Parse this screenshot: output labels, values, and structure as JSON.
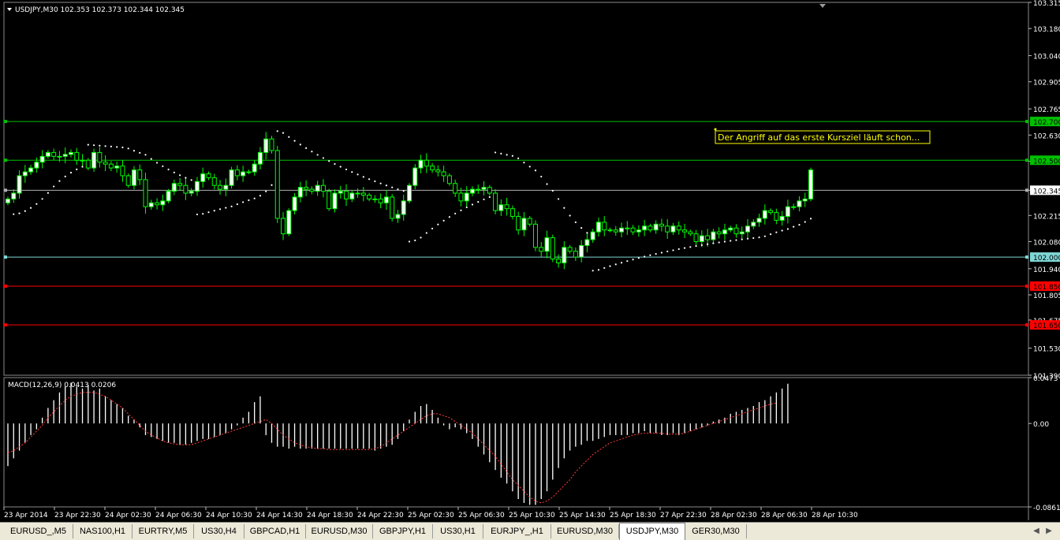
{
  "colors": {
    "background": "#000000",
    "up_candle": "#ffffff",
    "down_candle": "#000000",
    "candle_outline": "#00ff00",
    "macd_hist": "#ffffff",
    "macd_signal": "#ff3b3b",
    "green_line": "#00c000",
    "red_line": "#ff0000",
    "price_line": "#b0b0b0",
    "cyan_line": "#7fd7d7",
    "annotation": "#ffff00"
  },
  "header": {
    "symbol_label": "USDJPY,M30  102.353 102.373 102.344 102.345"
  },
  "annotation": {
    "text": "Der Angriff auf das erste Kursziel läuft schon..."
  },
  "chart_data": [
    {
      "type": "candlestick",
      "title": "USDJPY,M30",
      "ohlc_header": [
        102.353,
        102.373,
        102.344,
        102.345
      ],
      "ylim": [
        101.39,
        103.315
      ],
      "y_ticks": [
        "103.315",
        "103.180",
        "103.040",
        "102.905",
        "102.765",
        "102.630",
        "102.495",
        "102.345",
        "102.215",
        "102.080",
        "101.940",
        "101.805",
        "101.675",
        "101.530",
        "101.390"
      ],
      "x_ticks": [
        "23 Apr 2014",
        "23 Apr 22:30",
        "24 Apr 02:30",
        "24 Apr 06:30",
        "24 Apr 10:30",
        "24 Apr 14:30",
        "24 Apr 18:30",
        "24 Apr 22:30",
        "25 Apr 02:30",
        "25 Apr 06:30",
        "25 Apr 10:30",
        "25 Apr 14:30",
        "25 Apr 18:30",
        "27 Apr 22:30",
        "28 Apr 02:30",
        "28 Apr 06:30",
        "28 Apr 10:30"
      ],
      "levels": [
        {
          "label": "102.700",
          "value": 102.7,
          "color": "#00c000",
          "tag_bg": "#00c000"
        },
        {
          "label": "102.500",
          "value": 102.5,
          "color": "#00c000",
          "tag_bg": "#00c000"
        },
        {
          "label": "102.345",
          "value": 102.345,
          "color": "#b0b0b0",
          "tag_bg": "#ffffff"
        },
        {
          "label": "102.000",
          "value": 102.0,
          "color": "#7fd7d7",
          "tag_bg": "#7fd7d7"
        },
        {
          "label": "101.850",
          "value": 101.85,
          "color": "#ff0000",
          "tag_bg": "#ff0000"
        },
        {
          "label": "101.650",
          "value": 101.65,
          "color": "#ff0000",
          "tag_bg": "#ff0000"
        }
      ],
      "close": [
        102.3,
        102.33,
        102.42,
        102.44,
        102.46,
        102.49,
        102.52,
        102.54,
        102.52,
        102.52,
        102.53,
        102.54,
        102.5,
        102.5,
        102.46,
        102.54,
        102.49,
        102.48,
        102.46,
        102.47,
        102.42,
        102.37,
        102.45,
        102.4,
        102.26,
        102.28,
        102.27,
        102.29,
        102.34,
        102.38,
        102.37,
        102.33,
        102.34,
        102.39,
        102.43,
        102.41,
        102.37,
        102.35,
        102.37,
        102.45,
        102.42,
        102.44,
        102.44,
        102.48,
        102.54,
        102.61,
        102.55,
        102.2,
        102.12,
        102.24,
        102.31,
        102.36,
        102.35,
        102.34,
        102.37,
        102.34,
        102.25,
        102.33,
        102.34,
        102.3,
        102.33,
        102.33,
        102.32,
        102.3,
        102.3,
        102.28,
        102.31,
        102.2,
        102.22,
        102.29,
        102.37,
        102.46,
        102.5,
        102.47,
        102.45,
        102.44,
        102.42,
        102.38,
        102.33,
        102.29,
        102.33,
        102.35,
        102.35,
        102.36,
        102.33,
        102.24,
        102.27,
        102.25,
        102.21,
        102.14,
        102.2,
        102.17,
        102.05,
        102.03,
        102.1,
        101.99,
        101.97,
        102.05,
        102.03,
        102.0,
        102.06,
        102.09,
        102.13,
        102.18,
        102.14,
        102.14,
        102.13,
        102.15,
        102.15,
        102.13,
        102.14,
        102.16,
        102.14,
        102.17,
        102.16,
        102.13,
        102.16,
        102.14,
        102.13,
        102.12,
        102.08,
        102.11,
        102.09,
        102.13,
        102.12,
        102.14,
        102.15,
        102.12,
        102.13,
        102.16,
        102.18,
        102.2,
        102.24,
        102.23,
        102.19,
        102.21,
        102.26,
        102.26,
        102.29,
        102.3,
        102.45
      ]
    },
    {
      "type": "bar",
      "title": "MACD(12,26,9) 0.0413 0.0206",
      "name": "MACD",
      "params": [
        12,
        26,
        9
      ],
      "header_values": [
        0.0413,
        0.0206
      ],
      "ylim": [
        -0.0861,
        0.0473
      ],
      "y_ticks": [
        "0.0473",
        "0.00",
        "-0.0861"
      ],
      "histogram": [
        -0.044,
        -0.036,
        -0.028,
        -0.02,
        -0.012,
        -0.006,
        0.006,
        0.016,
        0.024,
        0.032,
        0.038,
        0.042,
        0.038,
        0.036,
        0.04,
        0.034,
        0.036,
        0.028,
        0.024,
        0.02,
        0.016,
        0.008,
        0.004,
        -0.004,
        -0.012,
        -0.014,
        -0.016,
        -0.018,
        -0.02,
        -0.02,
        -0.022,
        -0.022,
        -0.02,
        -0.018,
        -0.016,
        -0.016,
        -0.014,
        -0.012,
        -0.01,
        -0.006,
        -0.002,
        0.006,
        0.012,
        0.022,
        0.028,
        -0.012,
        -0.02,
        -0.024,
        -0.024,
        -0.026,
        -0.024,
        -0.026,
        -0.026,
        -0.026,
        -0.026,
        -0.026,
        -0.026,
        -0.026,
        -0.026,
        -0.026,
        -0.026,
        -0.026,
        -0.026,
        -0.026,
        -0.028,
        -0.026,
        -0.024,
        -0.022,
        -0.016,
        -0.008,
        0.004,
        0.012,
        0.018,
        0.02,
        0.014,
        0.006,
        -0.002,
        -0.006,
        -0.004,
        -0.006,
        -0.01,
        -0.016,
        -0.024,
        -0.032,
        -0.04,
        -0.048,
        -0.056,
        -0.062,
        -0.07,
        -0.078,
        -0.082,
        -0.084,
        -0.084,
        -0.078,
        -0.07,
        -0.058,
        -0.046,
        -0.036,
        -0.028,
        -0.024,
        -0.022,
        -0.018,
        -0.018,
        -0.016,
        -0.014,
        -0.012,
        -0.012,
        -0.012,
        -0.012,
        -0.01,
        -0.01,
        -0.008,
        -0.01,
        -0.01,
        -0.012,
        -0.012,
        -0.01,
        -0.012,
        -0.01,
        -0.008,
        -0.006,
        -0.004,
        -0.002,
        0.002,
        0.004,
        0.006,
        0.01,
        0.012,
        0.014,
        0.016,
        0.018,
        0.022,
        0.024,
        0.028,
        0.032,
        0.036,
        0.041
      ],
      "signal": [
        -0.03,
        -0.028,
        -0.024,
        -0.02,
        -0.014,
        -0.008,
        -0.002,
        0.006,
        0.012,
        0.018,
        0.024,
        0.028,
        0.03,
        0.032,
        0.032,
        0.032,
        0.03,
        0.028,
        0.024,
        0.02,
        0.016,
        0.01,
        0.004,
        -0.002,
        -0.008,
        -0.012,
        -0.015,
        -0.018,
        -0.02,
        -0.021,
        -0.022,
        -0.022,
        -0.022,
        -0.02,
        -0.018,
        -0.016,
        -0.014,
        -0.012,
        -0.01,
        -0.008,
        -0.006,
        -0.004,
        -0.002,
        0.0,
        0.002,
        0.004,
        0.0,
        -0.006,
        -0.012,
        -0.016,
        -0.02,
        -0.022,
        -0.024,
        -0.025,
        -0.026,
        -0.026,
        -0.027,
        -0.027,
        -0.027,
        -0.027,
        -0.027,
        -0.027,
        -0.027,
        -0.027,
        -0.026,
        -0.024,
        -0.02,
        -0.016,
        -0.012,
        -0.008,
        -0.004,
        0.0,
        0.004,
        0.008,
        0.01,
        0.01,
        0.008,
        0.006,
        0.002,
        -0.002,
        -0.006,
        -0.01,
        -0.016,
        -0.022,
        -0.028,
        -0.034,
        -0.042,
        -0.05,
        -0.058,
        -0.064,
        -0.07,
        -0.076,
        -0.08,
        -0.082,
        -0.08,
        -0.076,
        -0.07,
        -0.064,
        -0.058,
        -0.05,
        -0.044,
        -0.038,
        -0.032,
        -0.028,
        -0.024,
        -0.02,
        -0.018,
        -0.016,
        -0.014,
        -0.012,
        -0.011,
        -0.01,
        -0.01,
        -0.01,
        -0.01,
        -0.011,
        -0.011,
        -0.011,
        -0.01,
        -0.008,
        -0.006,
        -0.004,
        -0.002,
        0.0,
        0.002,
        0.004,
        0.006,
        0.008,
        0.01,
        0.012,
        0.014,
        0.016,
        0.018,
        0.02,
        0.021
      ]
    }
  ],
  "tabs": [
    {
      "label": "EURUSD_,M5",
      "active": false
    },
    {
      "label": "NAS100,H1",
      "active": false
    },
    {
      "label": "EURTRY,M5",
      "active": false
    },
    {
      "label": "US30,H4",
      "active": false
    },
    {
      "label": "GBPCAD,H1",
      "active": false
    },
    {
      "label": "EURUSD,M30",
      "active": false
    },
    {
      "label": "GBPJPY,H1",
      "active": false
    },
    {
      "label": "US30,H1",
      "active": false
    },
    {
      "label": "EURJPY_,H1",
      "active": false
    },
    {
      "label": "EURUSD,M30",
      "active": false
    },
    {
      "label": "USDJPY,M30",
      "active": true
    },
    {
      "label": "GER30,M30",
      "active": false
    }
  ]
}
